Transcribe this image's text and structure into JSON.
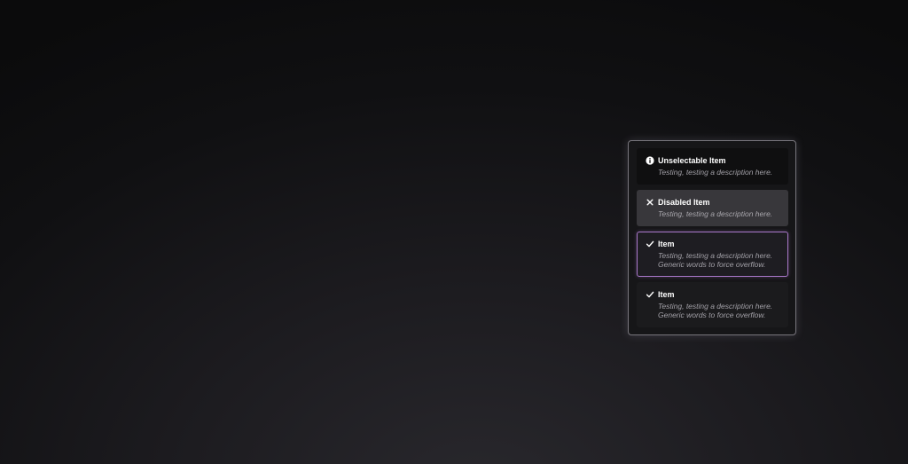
{
  "menu": {
    "items": [
      {
        "icon": "info-icon",
        "label": "Unselectable Item",
        "description": "Testing, testing a description here."
      },
      {
        "icon": "close-icon",
        "label": "Disabled Item",
        "description": "Testing, testing a description here."
      },
      {
        "icon": "check-icon",
        "label": "Item",
        "description": "Testing, testing a description here. Generic words to force overflow."
      },
      {
        "icon": "check-icon",
        "label": "Item",
        "description": "Testing, testing a description here. Generic words to force overflow."
      }
    ]
  },
  "colors": {
    "focus_border": "#a877c9",
    "menu_border": "#77757c",
    "disabled_background": "#38373b"
  }
}
